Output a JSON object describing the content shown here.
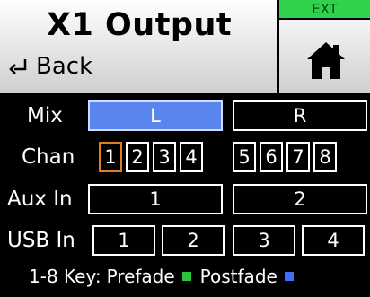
{
  "header": {
    "title": "X1 Output",
    "back_label": "Back",
    "ext_badge": "EXT"
  },
  "mix": {
    "label": "Mix",
    "options": [
      "L",
      "R"
    ],
    "selected": "L"
  },
  "chan": {
    "label": "Chan",
    "channels": [
      "1",
      "2",
      "3",
      "4",
      "5",
      "6",
      "7",
      "8"
    ],
    "highlighted": "1"
  },
  "aux_in": {
    "label": "Aux In",
    "options": [
      "1",
      "2"
    ]
  },
  "usb_in": {
    "label": "USB In",
    "options": [
      "1",
      "2",
      "3",
      "4"
    ]
  },
  "legend": {
    "key_label": "1-8 Key:",
    "prefade": "Prefade",
    "postfade": "Postfade",
    "prefade_color": "#2cc43d",
    "postfade_color": "#3f6df5"
  },
  "icons": {
    "back": "back-arrow-icon",
    "home": "home-icon"
  }
}
